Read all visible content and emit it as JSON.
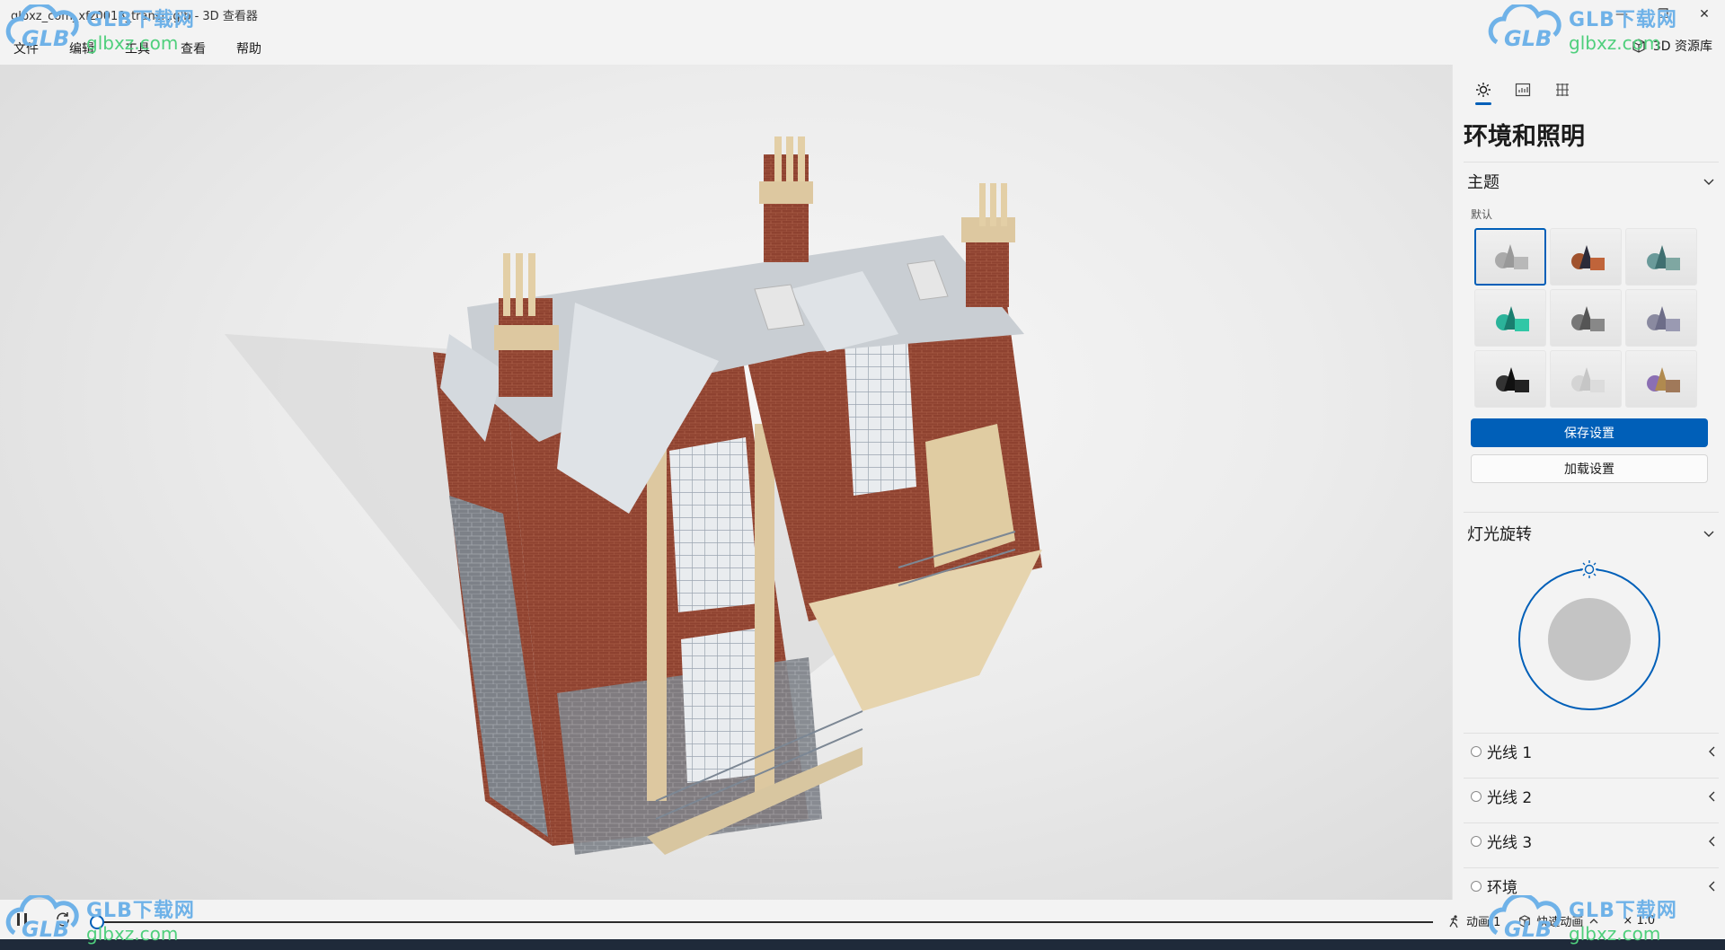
{
  "window": {
    "title": "glbxz_com_xfz0018_transit.glb - 3D 查看器",
    "minimize": "—",
    "maximize": "❐",
    "close": "✕"
  },
  "menu": {
    "items": [
      "文件",
      "编辑",
      "工具",
      "查看",
      "帮助"
    ],
    "resource_library": "3D 资源库"
  },
  "panel": {
    "title": "环境和照明",
    "theme_section": {
      "label": "主题",
      "sub_label": "默认"
    },
    "save_button": "保存设置",
    "load_button": "加载设置",
    "light_rotation": {
      "label": "灯光旋转"
    },
    "lights": [
      "光线 1",
      "光线 2",
      "光线 3",
      "环境"
    ]
  },
  "bottombar": {
    "animation_label": "动画 1",
    "quick_animation_label": "快速动画",
    "speed": "× 1.0"
  },
  "watermark": {
    "brand": "GLB下载网",
    "domain": "glbxz.com",
    "logo_text": "GLB"
  },
  "colors": {
    "accent": "#005fb8",
    "brick": "#8b3f2b",
    "stone": "#e3cfa6",
    "roof": "#c9ced3"
  }
}
